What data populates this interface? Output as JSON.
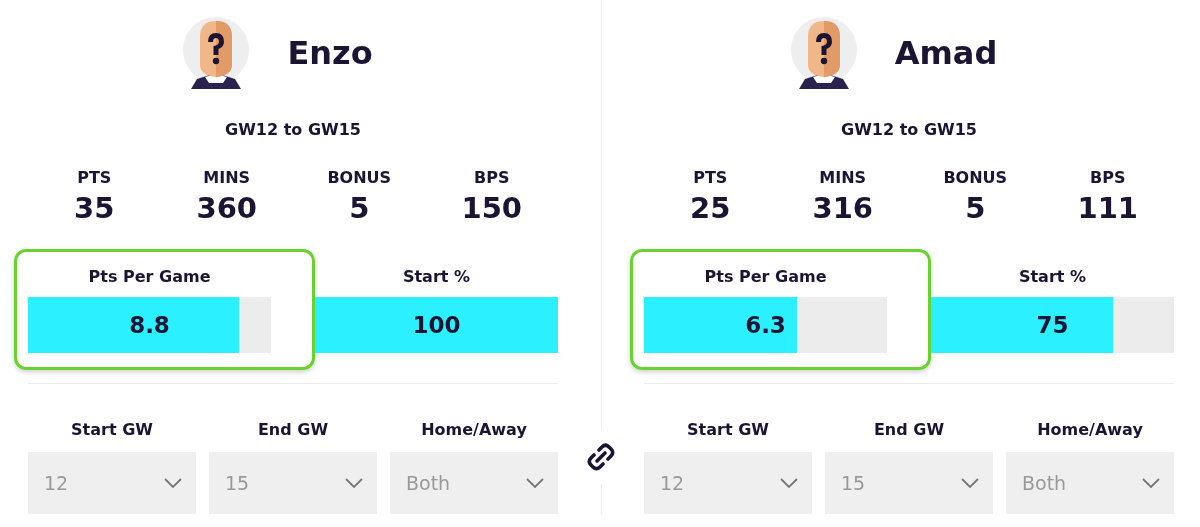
{
  "players": [
    {
      "name": "Enzo",
      "range": "GW12 to GW15",
      "stats": [
        {
          "label": "PTS",
          "value": "35"
        },
        {
          "label": "MINS",
          "value": "360"
        },
        {
          "label": "BONUS",
          "value": "5"
        },
        {
          "label": "BPS",
          "value": "150"
        }
      ],
      "metrics": [
        {
          "label": "Pts Per Game",
          "value": "8.8",
          "level": 0.87,
          "highlighted": true
        },
        {
          "label": "Start %",
          "value": "100",
          "level": 1.0,
          "highlighted": false
        }
      ],
      "filters": [
        {
          "label": "Start GW",
          "value": "12",
          "disabled": true
        },
        {
          "label": "End GW",
          "value": "15",
          "disabled": true
        },
        {
          "label": "Home/Away",
          "value": "Both",
          "disabled": true
        }
      ]
    },
    {
      "name": "Amad",
      "range": "GW12 to GW15",
      "stats": [
        {
          "label": "PTS",
          "value": "25"
        },
        {
          "label": "MINS",
          "value": "316"
        },
        {
          "label": "BONUS",
          "value": "5"
        },
        {
          "label": "BPS",
          "value": "111"
        }
      ],
      "metrics": [
        {
          "label": "Pts Per Game",
          "value": "6.3",
          "level": 0.63,
          "highlighted": true
        },
        {
          "label": "Start %",
          "value": "75",
          "level": 0.75,
          "highlighted": false
        }
      ],
      "filters": [
        {
          "label": "Start GW",
          "value": "12",
          "disabled": true
        },
        {
          "label": "End GW",
          "value": "15",
          "disabled": true
        },
        {
          "label": "Home/Away",
          "value": "Both",
          "disabled": true
        }
      ]
    }
  ]
}
